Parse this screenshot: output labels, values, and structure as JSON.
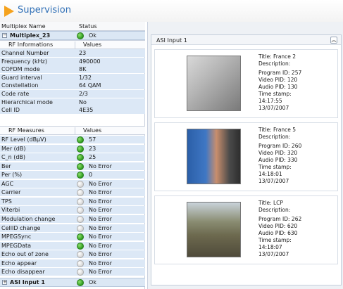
{
  "header": {
    "title": "Supervision"
  },
  "tree": {
    "col_name": "Multiplex Name",
    "col_status": "Status",
    "multiplex": {
      "name": "Multiplex_23",
      "status": "Ok"
    },
    "rf_info": {
      "title": "RF Informations",
      "values_label": "Values",
      "rows": [
        {
          "name": "Channel Number",
          "value": "23"
        },
        {
          "name": "Frequency (kHz)",
          "value": "490000"
        },
        {
          "name": "COFDM mode",
          "value": "8K"
        },
        {
          "name": "Guard interval",
          "value": "1/32"
        },
        {
          "name": "Constellation",
          "value": "64 QAM"
        },
        {
          "name": "Code rate",
          "value": "2/3"
        },
        {
          "name": "Hierarchical mode",
          "value": "No"
        },
        {
          "name": "Cell ID",
          "value": "4E35"
        }
      ]
    },
    "rf_measures": {
      "title": "RF Measures",
      "values_label": "Values",
      "rows": [
        {
          "name": "RF Level (dBµV)",
          "value": "57",
          "status": "green"
        },
        {
          "name": "Mer (dB)",
          "value": "23",
          "status": "green"
        },
        {
          "name": "C_n (dB)",
          "value": "25",
          "status": "green"
        },
        {
          "name": "Ber",
          "value": "No Error",
          "status": "green"
        },
        {
          "name": "Per (%)",
          "value": "0",
          "status": "green"
        },
        {
          "name": "AGC",
          "value": "No Error",
          "status": "grey"
        },
        {
          "name": "Carrier",
          "value": "No Error",
          "status": "grey"
        },
        {
          "name": "TPS",
          "value": "No Error",
          "status": "grey"
        },
        {
          "name": "Viterbi",
          "value": "No Error",
          "status": "grey"
        },
        {
          "name": "Modulation change",
          "value": "No Error",
          "status": "grey"
        },
        {
          "name": "CellID change",
          "value": "No Error",
          "status": "grey"
        },
        {
          "name": "MPEGSync",
          "value": "No Error",
          "status": "green"
        },
        {
          "name": "MPEGData",
          "value": "No Error",
          "status": "green"
        },
        {
          "name": "Echo out of zone",
          "value": "No Error",
          "status": "grey"
        },
        {
          "name": "Echo appear",
          "value": "No Error",
          "status": "grey"
        },
        {
          "name": "Echo disappear",
          "value": "No Error",
          "status": "grey"
        }
      ]
    },
    "asi_input": {
      "name": "ASI Input 1",
      "status": "Ok"
    }
  },
  "panel": {
    "title": "ASI Input 1",
    "collapse_icon": "double-chevron-up-icon",
    "programs": [
      {
        "title": "Title:  France 2",
        "description": "Description:",
        "program_id": "Program ID: 257",
        "video_pid": "Video PID: 120",
        "audio_pid": "Audio PID: 130",
        "timestamp_label": "Time stamp:",
        "time": "14:17:55",
        "date": "13/07/2007"
      },
      {
        "title": "Title:  France 5",
        "description": "Description:",
        "program_id": "Program ID: 260",
        "video_pid": "Video PID: 320",
        "audio_pid": "Audio PID: 330",
        "timestamp_label": "Time stamp:",
        "time": "14:18:01",
        "date": "13/07/2007"
      },
      {
        "title": "Title:  LCP",
        "description": "Description:",
        "program_id": "Program ID: 262",
        "video_pid": "Video PID: 620",
        "audio_pid": "Audio PID: 630",
        "timestamp_label": "Time stamp:",
        "time": "14:18:07",
        "date": "13/07/2007"
      }
    ]
  },
  "colors": {
    "accent": "#f5a21c",
    "title_blue": "#2f6fb6",
    "ok_green": "#2d9b1e"
  }
}
